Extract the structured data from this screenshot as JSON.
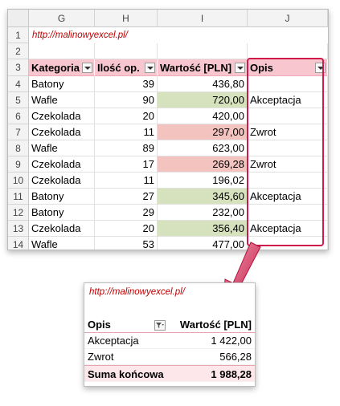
{
  "sheet": {
    "columns": [
      "G",
      "H",
      "I",
      "J"
    ],
    "rows": [
      "1",
      "2",
      "3",
      "4",
      "5",
      "6",
      "7",
      "8",
      "9",
      "10",
      "11",
      "12",
      "13",
      "14"
    ],
    "url": "http://malinowyexcel.pl/",
    "headers": [
      "Kategoria",
      "Ilość op.",
      "Wartość [PLN]",
      "Opis"
    ],
    "data": [
      {
        "kategoria": "Batony",
        "ilosc": "39",
        "wartosc": "436,80",
        "opis": "",
        "fill": "none"
      },
      {
        "kategoria": "Wafle",
        "ilosc": "90",
        "wartosc": "720,00",
        "opis": "Akceptacja",
        "fill": "green"
      },
      {
        "kategoria": "Czekolada",
        "ilosc": "20",
        "wartosc": "420,00",
        "opis": "",
        "fill": "none"
      },
      {
        "kategoria": "Czekolada",
        "ilosc": "11",
        "wartosc": "297,00",
        "opis": "Zwrot",
        "fill": "red"
      },
      {
        "kategoria": "Wafle",
        "ilosc": "89",
        "wartosc": "623,00",
        "opis": "",
        "fill": "none"
      },
      {
        "kategoria": "Czekolada",
        "ilosc": "17",
        "wartosc": "269,28",
        "opis": "Zwrot",
        "fill": "red"
      },
      {
        "kategoria": "Czekolada",
        "ilosc": "11",
        "wartosc": "196,02",
        "opis": "",
        "fill": "none"
      },
      {
        "kategoria": "Batony",
        "ilosc": "27",
        "wartosc": "345,60",
        "opis": "Akceptacja",
        "fill": "green"
      },
      {
        "kategoria": "Batony",
        "ilosc": "29",
        "wartosc": "232,00",
        "opis": "",
        "fill": "none"
      },
      {
        "kategoria": "Czekolada",
        "ilosc": "20",
        "wartosc": "356,40",
        "opis": "Akceptacja",
        "fill": "green"
      },
      {
        "kategoria": "Wafle",
        "ilosc": "53",
        "wartosc": "477,00",
        "opis": "",
        "fill": "none"
      }
    ],
    "colors": {
      "header_fill": "#f8c6cf",
      "green_fill": "#d6e2be",
      "red_fill": "#f3c3c0",
      "accent": "#d0184a"
    }
  },
  "pivot": {
    "url": "http://malinowyexcel.pl/",
    "header_label": "Opis",
    "header_value": "Wartość [PLN]",
    "rows": [
      {
        "label": "Akceptacja",
        "value": "1 422,00"
      },
      {
        "label": "Zwrot",
        "value": "566,28"
      }
    ],
    "total_label": "Suma końcowa",
    "total_value": "1 988,28",
    "filter_icon": "filter-icon"
  }
}
